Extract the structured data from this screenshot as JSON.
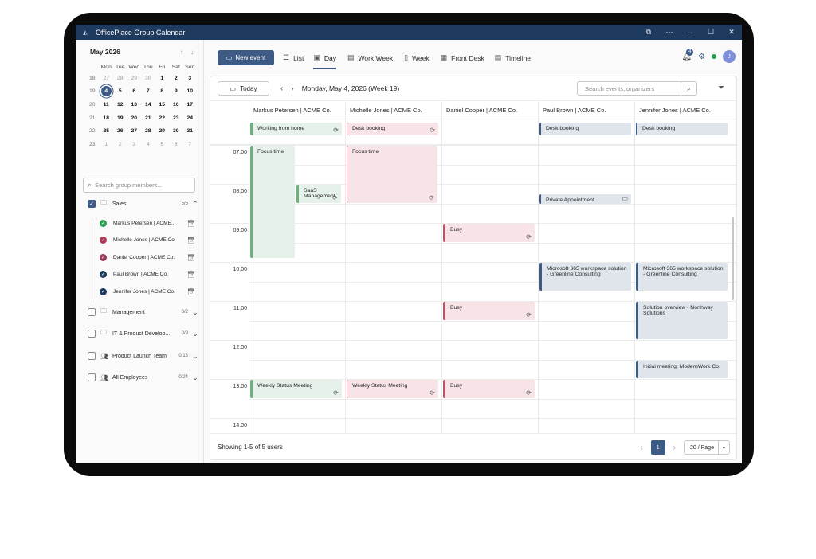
{
  "window": {
    "title": "OfficePlace Group Calendar",
    "logo_icon": "officeplace-logo-icon",
    "controls": [
      "⧉",
      "⋯",
      "─",
      "☐",
      "✕"
    ]
  },
  "mini_calendar": {
    "month_label": "May 2026",
    "weekdays": [
      "Mon",
      "Tue",
      "Wed",
      "Thu",
      "Fri",
      "Sat",
      "Sun"
    ],
    "weeks": [
      {
        "wk": "18",
        "days": [
          "27",
          "28",
          "29",
          "30",
          "1",
          "2",
          "3"
        ]
      },
      {
        "wk": "19",
        "days": [
          "4",
          "5",
          "6",
          "7",
          "8",
          "9",
          "10"
        ]
      },
      {
        "wk": "20",
        "days": [
          "11",
          "12",
          "13",
          "14",
          "15",
          "16",
          "17"
        ]
      },
      {
        "wk": "21",
        "days": [
          "18",
          "19",
          "20",
          "21",
          "22",
          "23",
          "24"
        ]
      },
      {
        "wk": "22",
        "days": [
          "25",
          "26",
          "27",
          "28",
          "29",
          "30",
          "31"
        ]
      },
      {
        "wk": "23",
        "days": [
          "1",
          "2",
          "3",
          "4",
          "5",
          "6",
          "7"
        ]
      }
    ],
    "selected_day": "4"
  },
  "sidebar": {
    "search_placeholder": "Search group members...",
    "groups": [
      {
        "label": "Sales",
        "count": "5/5",
        "checked": true,
        "icon": "folder-icon",
        "expanded": true
      },
      {
        "label": "Management",
        "count": "0/2",
        "checked": false,
        "icon": "folder-icon",
        "expanded": false
      },
      {
        "label": "IT & Product Develop...",
        "count": "0/9",
        "checked": false,
        "icon": "folder-icon",
        "expanded": false
      },
      {
        "label": "Product Launch Team",
        "count": "0/13",
        "checked": false,
        "icon": "people-icon",
        "expanded": false
      },
      {
        "label": "All Employees",
        "count": "0/24",
        "checked": false,
        "icon": "people-icon",
        "expanded": false
      }
    ],
    "members": [
      {
        "label": "Markus Petersen | ACME...",
        "status_color": "#2f9e57"
      },
      {
        "label": "Michelle Jones | ACME Co.",
        "status_color": "#b03a55"
      },
      {
        "label": "Daniel Cooper | ACME Co.",
        "status_color": "#9a3d5c"
      },
      {
        "label": "Paul Brown | ACME Co.",
        "status_color": "#1f3a5f"
      },
      {
        "label": "Jennifer Jones | ACME Co.",
        "status_color": "#1f3a5f"
      }
    ]
  },
  "toolbar": {
    "new_event": "New event",
    "views": [
      {
        "label": "List",
        "icon": "list-icon",
        "active": false
      },
      {
        "label": "Day",
        "icon": "day-icon",
        "active": true
      },
      {
        "label": "Work Week",
        "icon": "workweek-icon",
        "active": false
      },
      {
        "label": "Week",
        "icon": "week-icon",
        "active": false
      },
      {
        "label": "Front Desk",
        "icon": "frontdesk-icon",
        "active": false
      },
      {
        "label": "Timeline",
        "icon": "timeline-icon",
        "active": false
      }
    ],
    "notifications_count": "4",
    "avatar_initial": "J"
  },
  "navbar": {
    "today": "Today",
    "date_label": "Monday, May 4, 2026 (Week 19)",
    "search_placeholder": "Search events, organizers"
  },
  "columns": [
    "Markus Petersen | ACME Co.",
    "Michelle Jones | ACME Co.",
    "Daniel Cooper | ACME Co.",
    "Paul Brown | ACME Co.",
    "Jennifer Jones | ACME Co."
  ],
  "all_day": [
    {
      "col": 0,
      "title": "Working from home",
      "style": "green",
      "recurring": true
    },
    {
      "col": 1,
      "title": "Desk booking",
      "style": "pinkout",
      "recurring": true
    },
    {
      "col": 3,
      "title": "Desk booking",
      "style": "grayout",
      "recurring": false
    },
    {
      "col": 4,
      "title": "Desk booking",
      "style": "grayout",
      "recurring": false
    }
  ],
  "hours": [
    "07:00",
    "08:00",
    "09:00",
    "10:00",
    "11:00",
    "12:00",
    "13:00",
    "14:00"
  ],
  "events": [
    {
      "col": 0,
      "title": "Focus time",
      "start": "07:00",
      "end": "09:55",
      "style": "green",
      "recurring": false,
      "sub": 0
    },
    {
      "col": 0,
      "title": "SaaS Management",
      "start": "08:00",
      "end": "08:30",
      "style": "green",
      "recurring": true,
      "sub": 1
    },
    {
      "col": 1,
      "title": "Focus time",
      "start": "07:00",
      "end": "08:30",
      "style": "pinkout",
      "recurring": true,
      "sub": 0
    },
    {
      "col": 2,
      "title": "Busy",
      "start": "09:00",
      "end": "09:30",
      "style": "pink",
      "recurring": true,
      "sub": 0
    },
    {
      "col": 3,
      "title": "Private Appointment",
      "start": "08:15",
      "end": "08:30",
      "style": "grayout",
      "recurring": false,
      "sub": 0,
      "lock": true
    },
    {
      "col": 3,
      "title": "Microsoft 365 workspace solution - Greenline Consulting",
      "start": "10:00",
      "end": "10:45",
      "style": "gray",
      "recurring": false,
      "sub": 0
    },
    {
      "col": 4,
      "title": "Microsoft 365 workspace solution - Greenline Consulting",
      "start": "10:00",
      "end": "10:45",
      "style": "gray",
      "recurring": false,
      "sub": 0
    },
    {
      "col": 2,
      "title": "Busy",
      "start": "11:00",
      "end": "11:30",
      "style": "pink",
      "recurring": true,
      "sub": 0
    },
    {
      "col": 4,
      "title": "Solution overview - Northway Solutions",
      "start": "11:00",
      "end": "12:00",
      "style": "gray",
      "recurring": false,
      "sub": 0
    },
    {
      "col": 4,
      "title": "Initial meeting: ModernWork Co.",
      "start": "12:30",
      "end": "13:00",
      "style": "gray",
      "recurring": false,
      "sub": 0
    },
    {
      "col": 0,
      "title": "Weekly Status Meeting",
      "start": "13:00",
      "end": "13:30",
      "style": "green",
      "recurring": true,
      "sub": 0
    },
    {
      "col": 1,
      "title": "Weekly Status Meeting",
      "start": "13:00",
      "end": "13:30",
      "style": "pinkout",
      "recurring": true,
      "sub": 0
    },
    {
      "col": 2,
      "title": "Busy",
      "start": "13:00",
      "end": "13:30",
      "style": "pink",
      "recurring": true,
      "sub": 0
    }
  ],
  "footer": {
    "showing": "Showing 1-5 of 5 users",
    "page": "1",
    "per_page": "20 / Page"
  }
}
